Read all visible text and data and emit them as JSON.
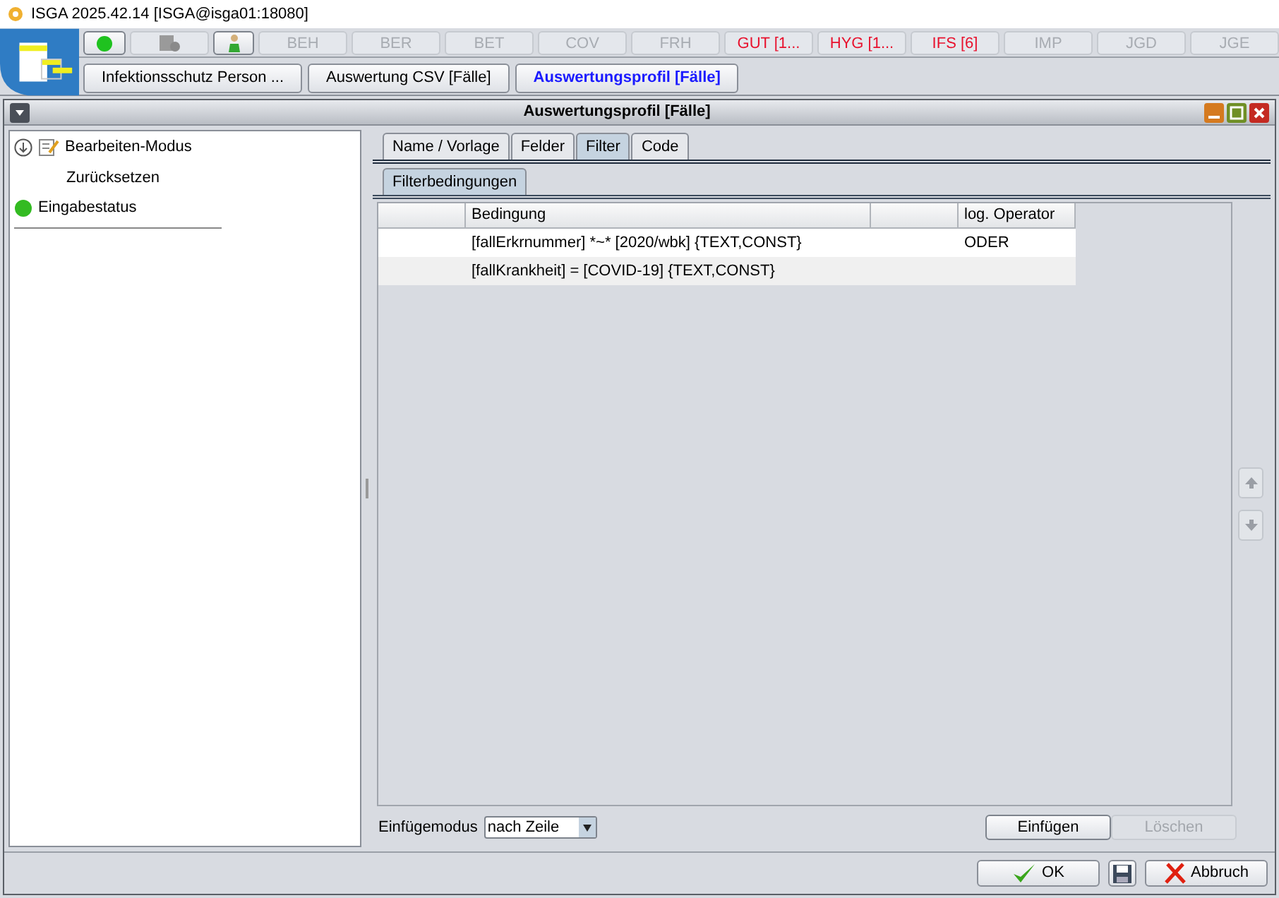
{
  "app_title": "ISGA 2025.42.14  [ISGA@isga01:18080]",
  "icon_buttons": [
    {
      "kind": "status",
      "enabled": true
    },
    {
      "kind": "database",
      "enabled": false
    },
    {
      "kind": "person",
      "enabled": true
    }
  ],
  "module_buttons": [
    {
      "label": "BEH",
      "alert": false
    },
    {
      "label": "BER",
      "alert": false
    },
    {
      "label": "BET",
      "alert": false
    },
    {
      "label": "COV",
      "alert": false
    },
    {
      "label": "FRH",
      "alert": false
    },
    {
      "label": "GUT [1...",
      "alert": true
    },
    {
      "label": "HYG [1...",
      "alert": true
    },
    {
      "label": "IFS [6]",
      "alert": true
    },
    {
      "label": "IMP",
      "alert": false
    },
    {
      "label": "JGD",
      "alert": false
    },
    {
      "label": "JGE",
      "alert": false
    }
  ],
  "open_tabs": [
    {
      "label": "Infektionsschutz Person  ...",
      "selected": false
    },
    {
      "label": "Auswertung CSV [Fälle]",
      "selected": false
    },
    {
      "label": "Auswertungsprofil [Fälle]",
      "selected": true
    }
  ],
  "window": {
    "title": "Auswertungsprofil [Fälle]"
  },
  "side_menu": [
    {
      "kind": "edit",
      "label": "Bearbeiten-Modus"
    },
    {
      "kind": "sub",
      "label": "Zurücksetzen"
    },
    {
      "kind": "status",
      "label": "Eingabestatus"
    }
  ],
  "tabs": [
    {
      "label": "Name / Vorlage",
      "selected": false
    },
    {
      "label": "Felder",
      "selected": false
    },
    {
      "label": "Filter",
      "selected": true
    },
    {
      "label": "Code",
      "selected": false
    }
  ],
  "subtabs": [
    {
      "label": "Filterbedingungen",
      "selected": true
    }
  ],
  "table": {
    "columns": [
      "Bedingung",
      "log. Operator"
    ],
    "rows": [
      [
        "[fallErkrnummer] *~* [2020/wbk]  {TEXT,CONST}",
        "ODER"
      ],
      [
        "[fallKrankheit] = [COVID-19]  {TEXT,CONST}",
        ""
      ]
    ]
  },
  "insert_mode": {
    "label": "Einfügemodus",
    "value": "nach Zeile"
  },
  "insert_button": {
    "label": "Einfügen",
    "disabled": false
  },
  "delete_button": {
    "label": "Löschen",
    "disabled": true
  },
  "ok_button": "OK",
  "cancel_button": "Abbruch"
}
